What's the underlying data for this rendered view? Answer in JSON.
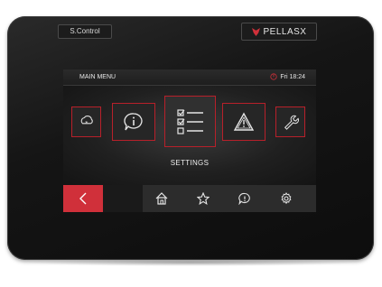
{
  "device": {
    "model_label": "S.Control",
    "brand_label": "PELLASX",
    "brand_color": "#d0303a"
  },
  "status_bar": {
    "title": "MAIN MENU",
    "clock": "Fri 18:24",
    "clock_icon": "power-icon"
  },
  "menu": {
    "selected_caption": "SETTINGS",
    "items": [
      {
        "icon": "weather-icon",
        "selected": false
      },
      {
        "icon": "info-icon",
        "selected": false
      },
      {
        "icon": "settings-list-icon",
        "selected": true
      },
      {
        "icon": "warning-icon",
        "selected": false
      },
      {
        "icon": "wrench-icon",
        "selected": false
      }
    ]
  },
  "bottom_bar": {
    "back_icon": "chevron-left-icon",
    "nav_icons": [
      "home-icon",
      "star-icon",
      "message-icon",
      "gear-icon"
    ],
    "accent": "#d0303a"
  }
}
